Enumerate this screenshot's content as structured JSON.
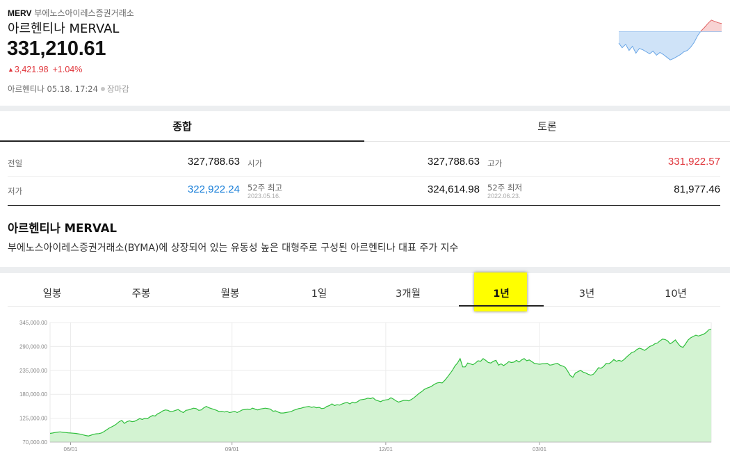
{
  "header": {
    "code": "MERV",
    "exchange": "부에노스아이레스증권거래소",
    "name": "아르헨티나 MERVAL",
    "price": "331,210.61",
    "change_abs": "3,421.98",
    "change_pct": "+1.04%",
    "meta_text": "아르헨티나 05.18. 17:24",
    "status": "장마감",
    "change_color": "#e0353b"
  },
  "icons": {
    "up": "up-triangle-icon",
    "status": "gray-dot-icon"
  },
  "tabs": [
    {
      "label": "종합",
      "active": true
    },
    {
      "label": "토론",
      "active": false
    }
  ],
  "stats": {
    "prev_close": {
      "label": "전일",
      "value": "327,788.63"
    },
    "open": {
      "label": "시가",
      "value": "327,788.63"
    },
    "high": {
      "label": "고가",
      "value": "331,922.57"
    },
    "low": {
      "label": "저가",
      "value": "322,922.24"
    },
    "high52": {
      "label": "52주 최고",
      "date": "2023.05.16.",
      "value": "324,614.98"
    },
    "low52": {
      "label": "52주 최저",
      "date": "2022.06.23.",
      "value": "81,977.46"
    }
  },
  "description": {
    "title": "아르헨티나 MERVAL",
    "text": "부에노스아이레스증권거래소(BYMA)에 상장되어 있는 유동성 높은 대형주로 구성된 아르헨티나 대표 주가 지수"
  },
  "periods": [
    {
      "label": "일봉",
      "active": false
    },
    {
      "label": "주봉",
      "active": false
    },
    {
      "label": "월봉",
      "active": false
    },
    {
      "label": "1일",
      "active": false
    },
    {
      "label": "3개월",
      "active": false
    },
    {
      "label": "1년",
      "active": true
    },
    {
      "label": "3년",
      "active": false
    },
    {
      "label": "10년",
      "active": false
    }
  ],
  "sparkline": {
    "prev_close_level": 327788.63,
    "below_color": "#cfe3f8",
    "above_color": "#f8d3d3",
    "values": [
      311000,
      304000,
      309000,
      300000,
      306000,
      296000,
      303000,
      301000,
      298000,
      295000,
      299000,
      293000,
      297000,
      294000,
      290000,
      286000,
      288000,
      291000,
      294000,
      298000,
      300000,
      305000,
      312000,
      322000,
      329000,
      334000,
      340000,
      345000,
      343000,
      341000,
      340000
    ]
  },
  "chart_data": {
    "type": "area",
    "ylim": [
      70000,
      345000
    ],
    "y_ticks": [
      70000,
      125000,
      180000,
      235000,
      290000,
      345000
    ],
    "y_tick_labels": [
      "70,000.00",
      "125,000.00",
      "180,000.00",
      "235,000.00",
      "290,000.00",
      "345,000.00"
    ],
    "x_tick_labels": [
      "06/01",
      "09/01",
      "12/01",
      "03/01"
    ],
    "x_tick_index": [
      8,
      71,
      131,
      191
    ],
    "grid": true,
    "line_color": "#2fbf3c",
    "fill_color": "#d3f3d2",
    "values": [
      90000,
      91000,
      92000,
      93000,
      93500,
      92500,
      92000,
      91500,
      91000,
      90500,
      90000,
      89000,
      88000,
      86500,
      85000,
      84000,
      86000,
      88000,
      89000,
      89500,
      91000,
      94000,
      98000,
      102000,
      105000,
      108000,
      112000,
      117000,
      120000,
      113000,
      117000,
      119000,
      117000,
      118000,
      121000,
      124000,
      122000,
      125000,
      124000,
      128000,
      131000,
      130000,
      135000,
      138000,
      142000,
      144000,
      143000,
      140000,
      141000,
      143000,
      145000,
      141000,
      138000,
      143000,
      144000,
      146000,
      148000,
      147000,
      143000,
      144000,
      149000,
      152000,
      149000,
      147000,
      145000,
      143000,
      140000,
      141000,
      139000,
      141000,
      138000,
      139000,
      141000,
      138000,
      141000,
      144000,
      145000,
      146000,
      145000,
      148000,
      146000,
      144000,
      146000,
      147000,
      148000,
      147000,
      146000,
      141000,
      142000,
      139000,
      137000,
      137000,
      138000,
      139000,
      140000,
      143000,
      145000,
      147000,
      148000,
      150000,
      151000,
      152000,
      150000,
      151000,
      149000,
      150000,
      147000,
      148000,
      152000,
      154000,
      158000,
      154000,
      156000,
      155000,
      158000,
      160000,
      161000,
      158000,
      162000,
      160000,
      163000,
      167000,
      168000,
      169000,
      171000,
      170000,
      172000,
      167000,
      165000,
      163000,
      166000,
      167000,
      168000,
      172000,
      169000,
      165000,
      162000,
      164000,
      166000,
      166000,
      165000,
      168000,
      172000,
      177000,
      182000,
      186000,
      191000,
      194000,
      196000,
      199000,
      203000,
      206000,
      207000,
      206000,
      212000,
      219000,
      227000,
      235000,
      245000,
      252000,
      262000,
      243000,
      243000,
      252000,
      250000,
      248000,
      252000,
      257000,
      256000,
      262000,
      258000,
      253000,
      252000,
      256000,
      258000,
      247000,
      250000,
      246000,
      250000,
      255000,
      253000,
      254000,
      258000,
      254000,
      259000,
      262000,
      257000,
      259000,
      255000,
      251000,
      250000,
      249000,
      250000,
      250000,
      251000,
      247000,
      248000,
      250000,
      251000,
      247000,
      245000,
      242000,
      233000,
      223000,
      219000,
      229000,
      232000,
      235000,
      231000,
      229000,
      226000,
      224000,
      226000,
      233000,
      241000,
      240000,
      244000,
      251000,
      250000,
      254000,
      260000,
      256000,
      258000,
      256000,
      260000,
      266000,
      271000,
      276000,
      278000,
      283000,
      286000,
      284000,
      281000,
      285000,
      290000,
      292000,
      296000,
      298000,
      303000,
      307000,
      306000,
      303000,
      296000,
      300000,
      305000,
      297000,
      290000,
      288000,
      296000,
      305000,
      310000,
      313000,
      316000,
      314000,
      316000,
      318000,
      322000,
      328000,
      330000
    ]
  }
}
